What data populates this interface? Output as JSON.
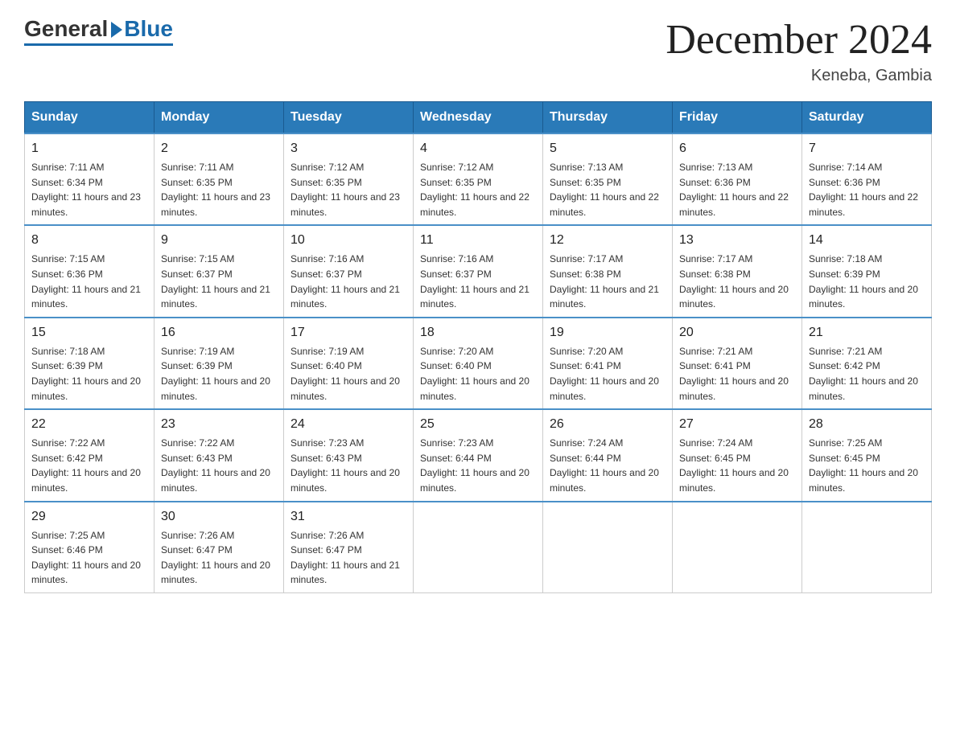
{
  "header": {
    "logo_general": "General",
    "logo_blue": "Blue",
    "title": "December 2024",
    "subtitle": "Keneba, Gambia"
  },
  "days_of_week": [
    "Sunday",
    "Monday",
    "Tuesday",
    "Wednesday",
    "Thursday",
    "Friday",
    "Saturday"
  ],
  "weeks": [
    [
      {
        "day": "1",
        "sunrise": "7:11 AM",
        "sunset": "6:34 PM",
        "daylight": "11 hours and 23 minutes."
      },
      {
        "day": "2",
        "sunrise": "7:11 AM",
        "sunset": "6:35 PM",
        "daylight": "11 hours and 23 minutes."
      },
      {
        "day": "3",
        "sunrise": "7:12 AM",
        "sunset": "6:35 PM",
        "daylight": "11 hours and 23 minutes."
      },
      {
        "day": "4",
        "sunrise": "7:12 AM",
        "sunset": "6:35 PM",
        "daylight": "11 hours and 22 minutes."
      },
      {
        "day": "5",
        "sunrise": "7:13 AM",
        "sunset": "6:35 PM",
        "daylight": "11 hours and 22 minutes."
      },
      {
        "day": "6",
        "sunrise": "7:13 AM",
        "sunset": "6:36 PM",
        "daylight": "11 hours and 22 minutes."
      },
      {
        "day": "7",
        "sunrise": "7:14 AM",
        "sunset": "6:36 PM",
        "daylight": "11 hours and 22 minutes."
      }
    ],
    [
      {
        "day": "8",
        "sunrise": "7:15 AM",
        "sunset": "6:36 PM",
        "daylight": "11 hours and 21 minutes."
      },
      {
        "day": "9",
        "sunrise": "7:15 AM",
        "sunset": "6:37 PM",
        "daylight": "11 hours and 21 minutes."
      },
      {
        "day": "10",
        "sunrise": "7:16 AM",
        "sunset": "6:37 PM",
        "daylight": "11 hours and 21 minutes."
      },
      {
        "day": "11",
        "sunrise": "7:16 AM",
        "sunset": "6:37 PM",
        "daylight": "11 hours and 21 minutes."
      },
      {
        "day": "12",
        "sunrise": "7:17 AM",
        "sunset": "6:38 PM",
        "daylight": "11 hours and 21 minutes."
      },
      {
        "day": "13",
        "sunrise": "7:17 AM",
        "sunset": "6:38 PM",
        "daylight": "11 hours and 20 minutes."
      },
      {
        "day": "14",
        "sunrise": "7:18 AM",
        "sunset": "6:39 PM",
        "daylight": "11 hours and 20 minutes."
      }
    ],
    [
      {
        "day": "15",
        "sunrise": "7:18 AM",
        "sunset": "6:39 PM",
        "daylight": "11 hours and 20 minutes."
      },
      {
        "day": "16",
        "sunrise": "7:19 AM",
        "sunset": "6:39 PM",
        "daylight": "11 hours and 20 minutes."
      },
      {
        "day": "17",
        "sunrise": "7:19 AM",
        "sunset": "6:40 PM",
        "daylight": "11 hours and 20 minutes."
      },
      {
        "day": "18",
        "sunrise": "7:20 AM",
        "sunset": "6:40 PM",
        "daylight": "11 hours and 20 minutes."
      },
      {
        "day": "19",
        "sunrise": "7:20 AM",
        "sunset": "6:41 PM",
        "daylight": "11 hours and 20 minutes."
      },
      {
        "day": "20",
        "sunrise": "7:21 AM",
        "sunset": "6:41 PM",
        "daylight": "11 hours and 20 minutes."
      },
      {
        "day": "21",
        "sunrise": "7:21 AM",
        "sunset": "6:42 PM",
        "daylight": "11 hours and 20 minutes."
      }
    ],
    [
      {
        "day": "22",
        "sunrise": "7:22 AM",
        "sunset": "6:42 PM",
        "daylight": "11 hours and 20 minutes."
      },
      {
        "day": "23",
        "sunrise": "7:22 AM",
        "sunset": "6:43 PM",
        "daylight": "11 hours and 20 minutes."
      },
      {
        "day": "24",
        "sunrise": "7:23 AM",
        "sunset": "6:43 PM",
        "daylight": "11 hours and 20 minutes."
      },
      {
        "day": "25",
        "sunrise": "7:23 AM",
        "sunset": "6:44 PM",
        "daylight": "11 hours and 20 minutes."
      },
      {
        "day": "26",
        "sunrise": "7:24 AM",
        "sunset": "6:44 PM",
        "daylight": "11 hours and 20 minutes."
      },
      {
        "day": "27",
        "sunrise": "7:24 AM",
        "sunset": "6:45 PM",
        "daylight": "11 hours and 20 minutes."
      },
      {
        "day": "28",
        "sunrise": "7:25 AM",
        "sunset": "6:45 PM",
        "daylight": "11 hours and 20 minutes."
      }
    ],
    [
      {
        "day": "29",
        "sunrise": "7:25 AM",
        "sunset": "6:46 PM",
        "daylight": "11 hours and 20 minutes."
      },
      {
        "day": "30",
        "sunrise": "7:26 AM",
        "sunset": "6:47 PM",
        "daylight": "11 hours and 20 minutes."
      },
      {
        "day": "31",
        "sunrise": "7:26 AM",
        "sunset": "6:47 PM",
        "daylight": "11 hours and 21 minutes."
      },
      null,
      null,
      null,
      null
    ]
  ],
  "labels": {
    "sunrise": "Sunrise: ",
    "sunset": "Sunset: ",
    "daylight": "Daylight: "
  }
}
